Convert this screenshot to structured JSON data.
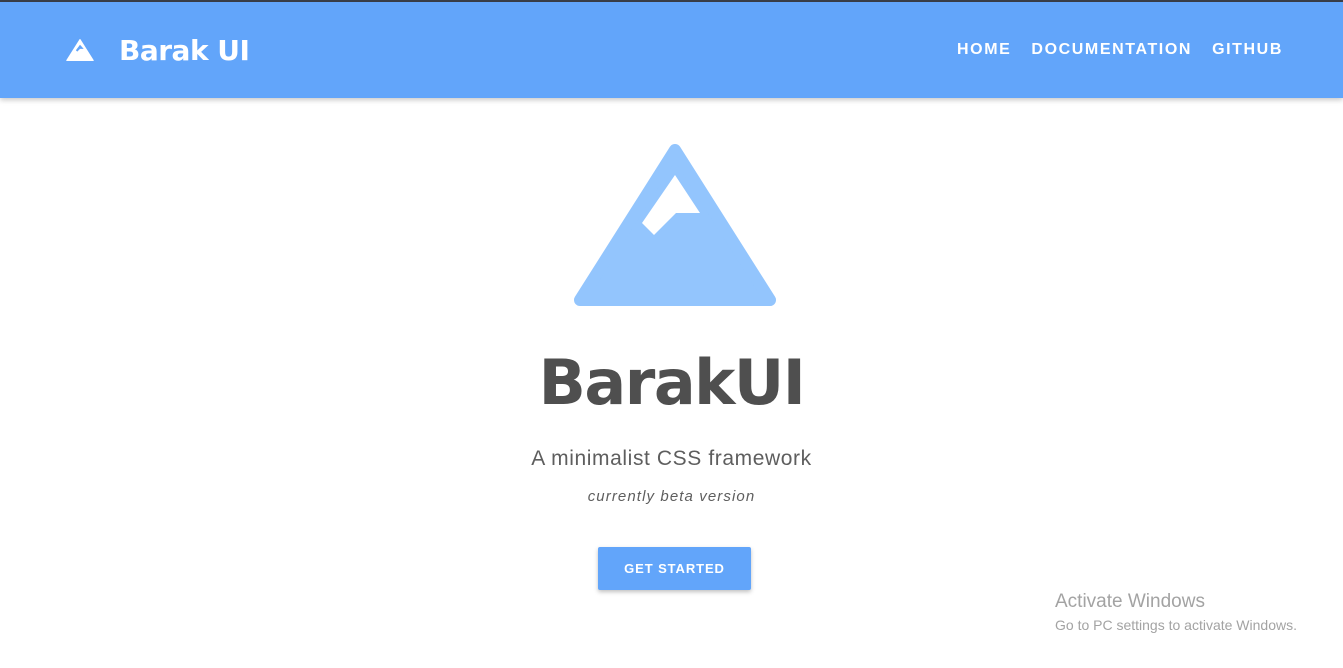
{
  "navbar": {
    "brand_name": "Barak UI",
    "logo_icon": "mountain-icon",
    "links": [
      "HOME",
      "DOCUMENTATION",
      "GITHUB"
    ],
    "background": "#62a5fa"
  },
  "hero": {
    "logo_icon": "mountain-icon",
    "title": "BarakUI",
    "subtitle": "A minimalist CSS framework",
    "note": "currently beta version",
    "cta_label": "GET STARTED",
    "logo_color": "#93c5fd"
  },
  "watermark": {
    "title": "Activate Windows",
    "subtitle": "Go to PC settings to activate Windows."
  }
}
